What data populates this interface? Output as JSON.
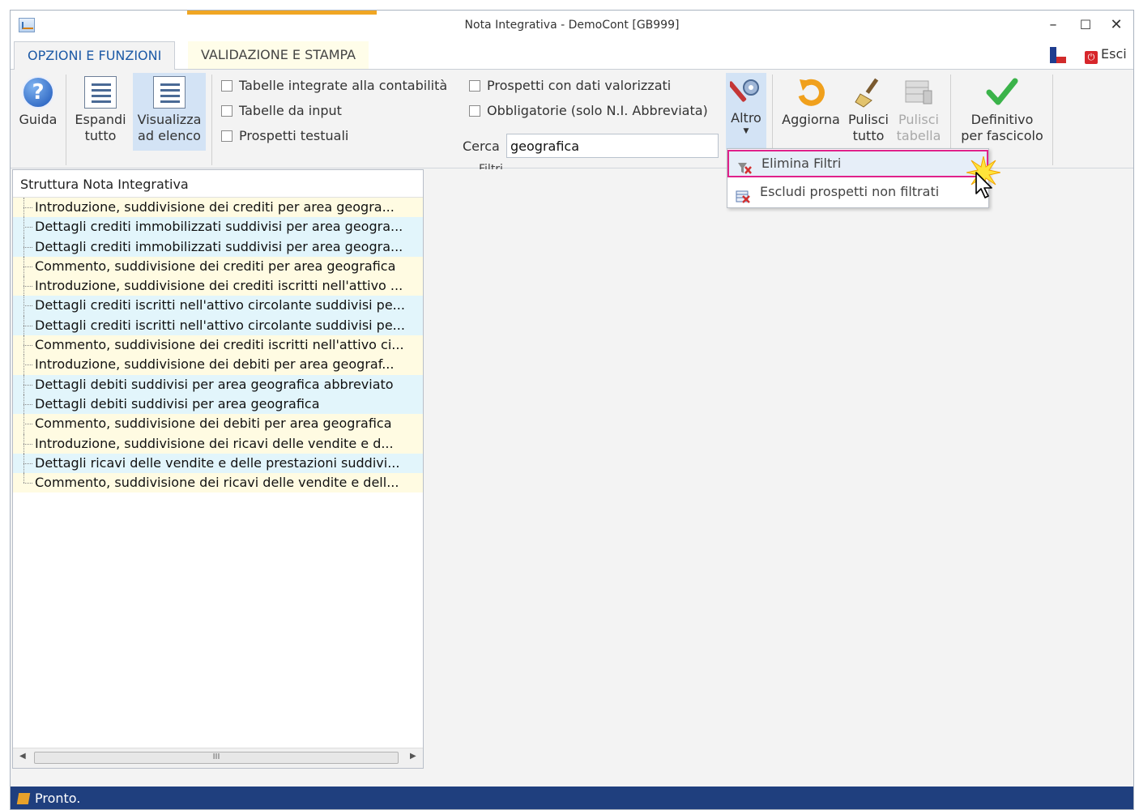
{
  "window": {
    "title": "Nota Integrativa - DemoCont [GB999]",
    "controls": {
      "minimize": "–",
      "maximize": "☐",
      "close": "✕"
    }
  },
  "tabs": [
    {
      "label": "OPZIONI E FUNZIONI",
      "active": true
    },
    {
      "label": "VALIDAZIONE E STAMPA",
      "active": false
    }
  ],
  "top_right": {
    "esci_label": "Esci",
    "esci_icon": "power-icon"
  },
  "ribbon": {
    "guida": "Guida",
    "espandi": [
      "Espandi",
      "tutto"
    ],
    "visualizza": [
      "Visualizza",
      "ad elenco"
    ],
    "filters": {
      "checkboxes": [
        "Tabelle integrate alla contabilità",
        "Tabelle da input",
        "Prospetti testuali",
        "Prospetti con dati valorizzati",
        "Obbligatorie (solo N.I. Abbreviata)"
      ],
      "cerca_label": "Cerca",
      "cerca_value": "geografica",
      "group_label": "Filtri"
    },
    "altro": "Altro",
    "aggiorna": "Aggiorna",
    "pulisci_tutto": [
      "Pulisci",
      "tutto"
    ],
    "pulisci_tabella": [
      "Pulisci",
      "tabella"
    ],
    "definitivo": [
      "Definitivo",
      "per fascicolo"
    ]
  },
  "dropdown": {
    "items": [
      {
        "label": "Elimina Filtri",
        "icon": "remove-filter-icon"
      },
      {
        "label": "Escludi prospetti non filtrati",
        "icon": "exclude-grid-icon"
      }
    ]
  },
  "tree": {
    "header": "Struttura Nota Integrativa",
    "nodes": [
      "Introduzione, suddivisione dei crediti per area geogra...",
      "Dettagli crediti immobilizzati suddivisi per area geogra...",
      "Dettagli crediti immobilizzati suddivisi per area geogra...",
      "Commento, suddivisione dei crediti per area geografica",
      "Introduzione, suddivisione dei crediti iscritti nell'attivo ...",
      "Dettagli crediti iscritti nell'attivo circolante suddivisi pe...",
      "Dettagli crediti iscritti nell'attivo circolante suddivisi pe...",
      "Commento, suddivisione dei crediti iscritti nell'attivo ci...",
      "Introduzione, suddivisione dei debiti per area geograf...",
      "Dettagli debiti suddivisi per area geografica abbreviato",
      "Dettagli debiti suddivisi per area geografica",
      "Commento, suddivisione dei debiti per area geografica",
      "Introduzione, suddivisione dei ricavi delle vendite e d...",
      "Dettagli ricavi delle vendite e delle prestazioni suddivi...",
      "Commento, suddivisione dei ricavi delle vendite e dell..."
    ],
    "scroll_thumb": "III"
  },
  "status": {
    "text": "Pronto."
  },
  "colors": {
    "accent": "#1d5aa6",
    "status_bg": "#1f3f7e",
    "highlight_border": "#e0218a"
  }
}
